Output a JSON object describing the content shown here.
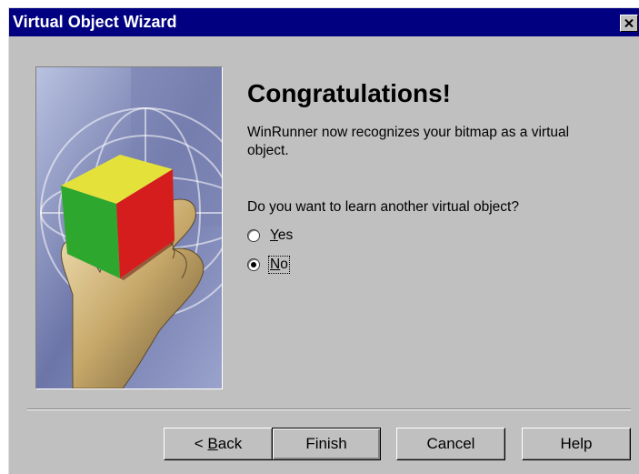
{
  "window": {
    "title": "Virtual Object Wizard",
    "close_glyph": "✕"
  },
  "content": {
    "heading": "Congratulations!",
    "description": "WinRunner now recognizes your bitmap as a virtual object.",
    "question": "Do you want to learn another virtual object?",
    "options": [
      {
        "label": "Yes",
        "mnemonic": "Y",
        "rest": "es",
        "selected": false
      },
      {
        "label": "No",
        "mnemonic": "N",
        "rest": "o",
        "selected": true
      }
    ]
  },
  "buttons": {
    "back_prefix": "< ",
    "back_mnemonic": "B",
    "back_rest": "ack",
    "finish": "Finish",
    "cancel": "Cancel",
    "help": "Help"
  },
  "icons": {
    "close": "close-icon",
    "illustration": "hand-holding-cube-illustration"
  },
  "colors": {
    "titlebar": "#000080",
    "face": "#c0c0c0"
  }
}
